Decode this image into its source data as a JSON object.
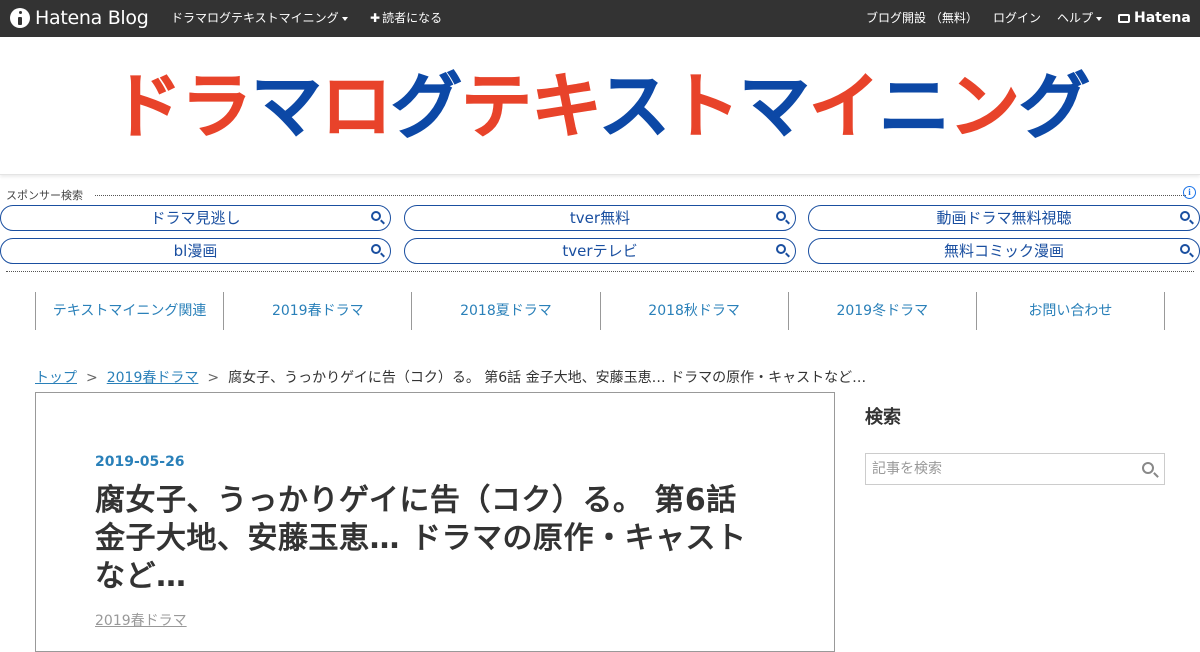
{
  "topbar": {
    "logo_text": "Hatena Blog",
    "blog_menu": "ドラマログテキストマイニング",
    "subscribe": "読者になる",
    "open_blog": "ブログ開設 （無料）",
    "login": "ログイン",
    "help": "ヘルプ",
    "hatena": "Hatena"
  },
  "banner": {
    "title_parts": [
      "ドラ",
      "マ",
      "ロ",
      "グ",
      "テ",
      "キ",
      "ス",
      "ト",
      "マ",
      "イ",
      "ニ",
      "ン",
      "グ"
    ],
    "colors": {
      "red": "#e8432a",
      "blue": "#0c48a6"
    }
  },
  "sponsor": {
    "label": "スポンサー検索",
    "info": "i",
    "pills": [
      "ドラマ見逃し",
      "tver無料",
      "動画ドラマ無料視聴",
      "bl漫画",
      "tverテレビ",
      "無料コミック漫画"
    ]
  },
  "gnav": [
    "テキストマイニング関連",
    "2019春ドラマ",
    "2018夏ドラマ",
    "2018秋ドラマ",
    "2019冬ドラマ",
    "お問い合わせ"
  ],
  "breadcrumb": {
    "top": "トップ",
    "sep": ">",
    "category": "2019春ドラマ",
    "current": "腐女子、うっかりゲイに告（コク）る。 第6話 金子大地、安藤玉恵… ドラマの原作・キャストなど…"
  },
  "entry": {
    "date": "2019-05-26",
    "title": "腐女子、うっかりゲイに告（コク）る。 第6話 金子大地、安藤玉恵… ドラマの原作・キャストなど…",
    "category": "2019春ドラマ"
  },
  "sidebar": {
    "search_title": "検索",
    "search_placeholder": "記事を検索"
  },
  "colors": {
    "topbar_bg": "#333333",
    "link": "#2a80b9",
    "ad_blue": "#1a4fa0"
  }
}
